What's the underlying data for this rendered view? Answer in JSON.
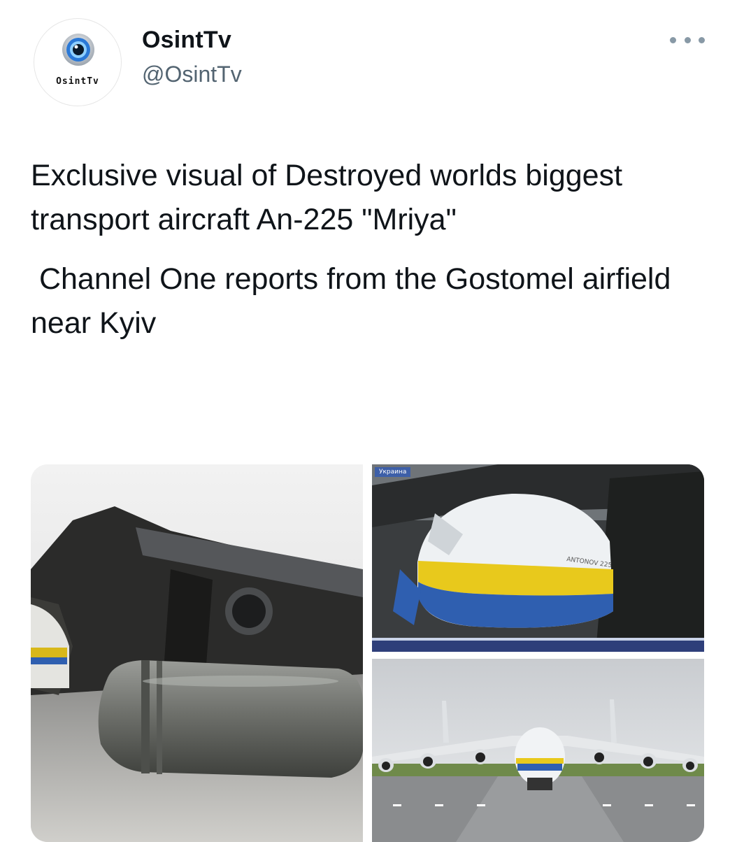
{
  "author": {
    "avatar_brand": "OsintTv",
    "display_name": "OsintTv",
    "handle": "@OsintTv"
  },
  "icons": {
    "more": "more-horizontal-icon",
    "avatar": "eye-logo-icon"
  },
  "tweet": {
    "paragraph_1": "Exclusive visual of Destroyed worlds biggest transport aircraft An-225 \"Mriya\"",
    "paragraph_2": " Channel One reports from the Gostomel airfield near Kyiv"
  },
  "media": {
    "tile_2_overlay": "Украина",
    "tile_2_fuselage_text": "ANTONOV 225"
  },
  "colors": {
    "handle": "#536471",
    "text": "#0f1419",
    "livery_yellow": "#e8c91c",
    "livery_blue": "#2f5fb0"
  }
}
